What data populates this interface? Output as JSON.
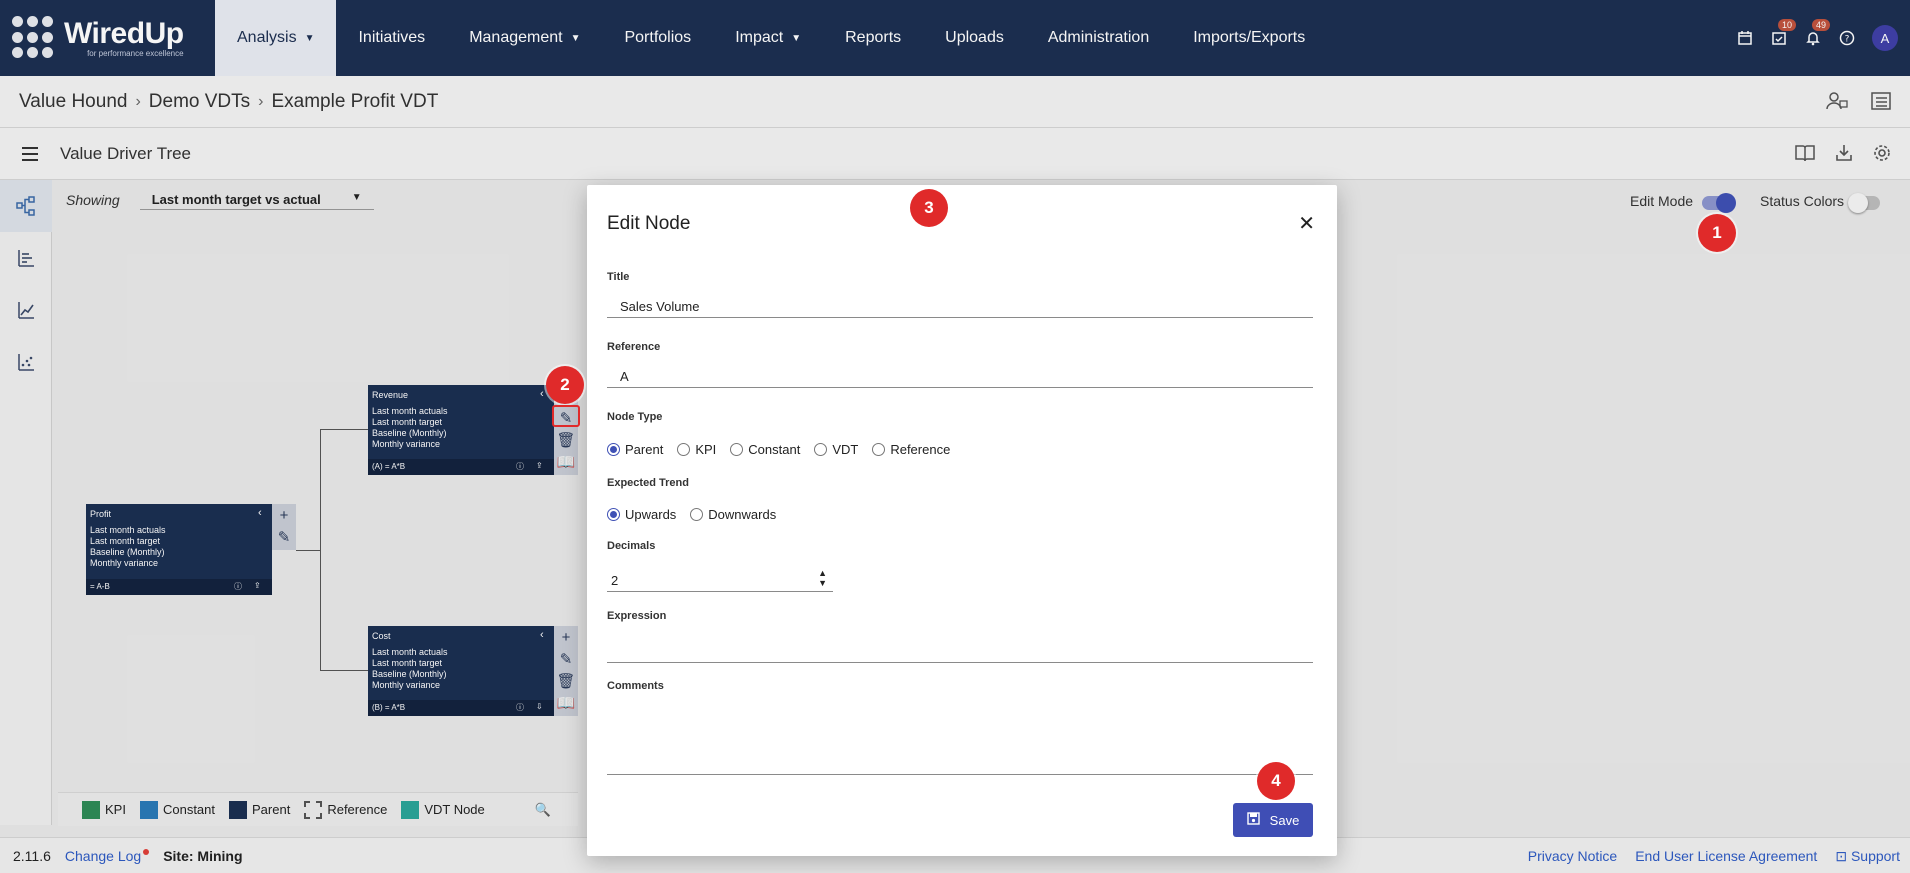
{
  "brand": {
    "name": "WiredUp",
    "tagline": "for performance excellence"
  },
  "nav": {
    "items": [
      {
        "label": "Analysis",
        "caret": true,
        "active": true
      },
      {
        "label": "Initiatives"
      },
      {
        "label": "Management",
        "caret": true
      },
      {
        "label": "Portfolios"
      },
      {
        "label": "Impact",
        "caret": true
      },
      {
        "label": "Reports"
      },
      {
        "label": "Uploads"
      },
      {
        "label": "Administration"
      },
      {
        "label": "Imports/Exports"
      }
    ],
    "tasks_badge": "10",
    "notifications_badge": "49",
    "avatar_letter": "A"
  },
  "breadcrumb": {
    "items": [
      "Value Hound",
      "Demo VDTs",
      "Example Profit VDT"
    ]
  },
  "toolbar": {
    "title": "Value Driver Tree"
  },
  "canvas": {
    "showing_label": "Showing",
    "showing_value": "Last month target vs actual",
    "edit_mode_label": "Edit Mode",
    "edit_mode_on": true,
    "status_colors_label": "Status Colors",
    "status_colors_on": false
  },
  "nodes": {
    "profit": {
      "title": "Profit",
      "lines": [
        "Last month actuals",
        "Last month target",
        "Baseline (Monthly)",
        "Monthly variance"
      ],
      "formula": "= A-B"
    },
    "revenue": {
      "title": "Revenue",
      "lines": [
        "Last month actuals",
        "Last month target",
        "Baseline (Monthly)",
        "Monthly variance"
      ],
      "formula": "(A) = A*B"
    },
    "cost": {
      "title": "Cost",
      "lines": [
        "Last month actuals",
        "Last month target",
        "Baseline (Monthly)",
        "Monthly variance"
      ],
      "formula": "(B) = A*B"
    }
  },
  "legend": {
    "items": [
      {
        "label": "KPI",
        "color": "#2e8b57"
      },
      {
        "label": "Constant",
        "color": "#2a7ab8"
      },
      {
        "label": "Parent",
        "color": "#1b2f52"
      },
      {
        "label": "Reference",
        "color": "dashed"
      },
      {
        "label": "VDT Node",
        "color": "#2aa59a"
      }
    ]
  },
  "footer": {
    "version": "2.11.6",
    "changelog": "Change Log",
    "site": "Site: Mining",
    "links": [
      "Privacy Notice",
      "End User License Agreement",
      "Support"
    ]
  },
  "modal": {
    "title": "Edit Node",
    "title_label": "Title",
    "title_value": "Sales Volume",
    "reference_label": "Reference",
    "reference_value": "A",
    "node_type_label": "Node Type",
    "node_types": [
      "Parent",
      "KPI",
      "Constant",
      "VDT",
      "Reference"
    ],
    "node_type_selected": "Parent",
    "trend_label": "Expected Trend",
    "trends": [
      "Upwards",
      "Downwards"
    ],
    "trend_selected": "Upwards",
    "decimals_label": "Decimals",
    "decimals_value": "2",
    "expression_label": "Expression",
    "expression_value": "",
    "comments_label": "Comments",
    "comments_value": "",
    "save_label": "Save"
  },
  "markers": [
    "1",
    "2",
    "3",
    "4"
  ],
  "colors": {
    "nav_bg": "#1d2f52",
    "node_bg": "#1b2f52",
    "accent": "#3f51b5",
    "marker": "#e02a2a"
  }
}
